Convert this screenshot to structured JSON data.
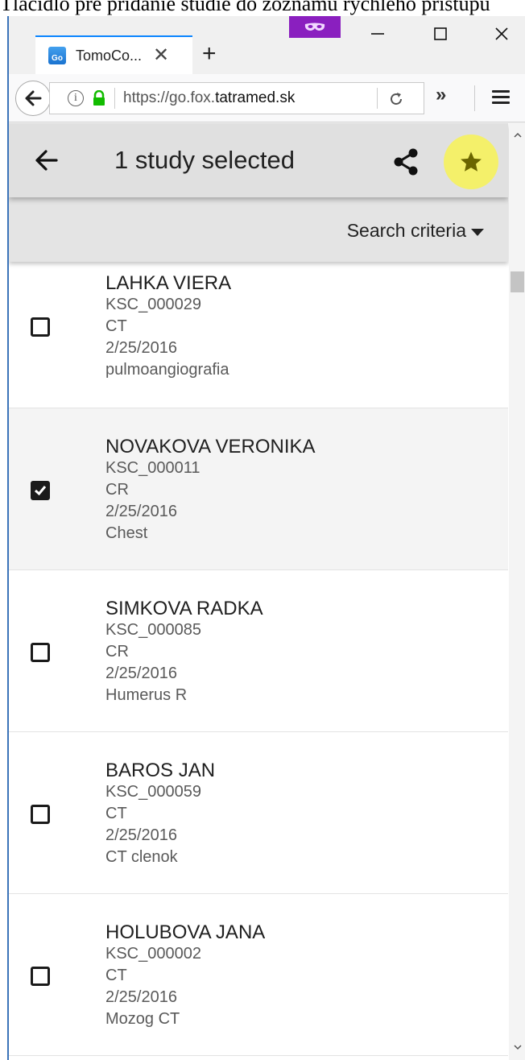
{
  "doc_caption": "Tlačidlo pre pridanie štúdie do zoznamu rýchleho prístupu",
  "browser": {
    "tab_title": "TomoCo...",
    "favicon_text": "Go",
    "url_prefix": "https://go.fox.",
    "url_domain": "tatramed.sk",
    "accent_color": "#0a84ff",
    "private_color": "#8a1fbf"
  },
  "appbar": {
    "title": "1 study selected",
    "star_color": "#f4f06a"
  },
  "criteria": {
    "label": "Search criteria"
  },
  "studies": [
    {
      "name": "LAHKA VIERA",
      "id": "KSC_000029",
      "modality": "CT",
      "date": "2/25/2016",
      "description": "pulmoangiografia",
      "checked": false
    },
    {
      "name": "NOVAKOVA VERONIKA",
      "id": "KSC_000011",
      "modality": "CR",
      "date": "2/25/2016",
      "description": "Chest",
      "checked": true
    },
    {
      "name": "SIMKOVA RADKA",
      "id": "KSC_000085",
      "modality": "CR",
      "date": "2/25/2016",
      "description": "Humerus R",
      "checked": false
    },
    {
      "name": "BAROS JAN",
      "id": "KSC_000059",
      "modality": "CT",
      "date": "2/25/2016",
      "description": "CT clenok",
      "checked": false
    },
    {
      "name": "HOLUBOVA JANA",
      "id": "KSC_000002",
      "modality": "CT",
      "date": "2/25/2016",
      "description": "Mozog CT",
      "checked": false
    }
  ]
}
